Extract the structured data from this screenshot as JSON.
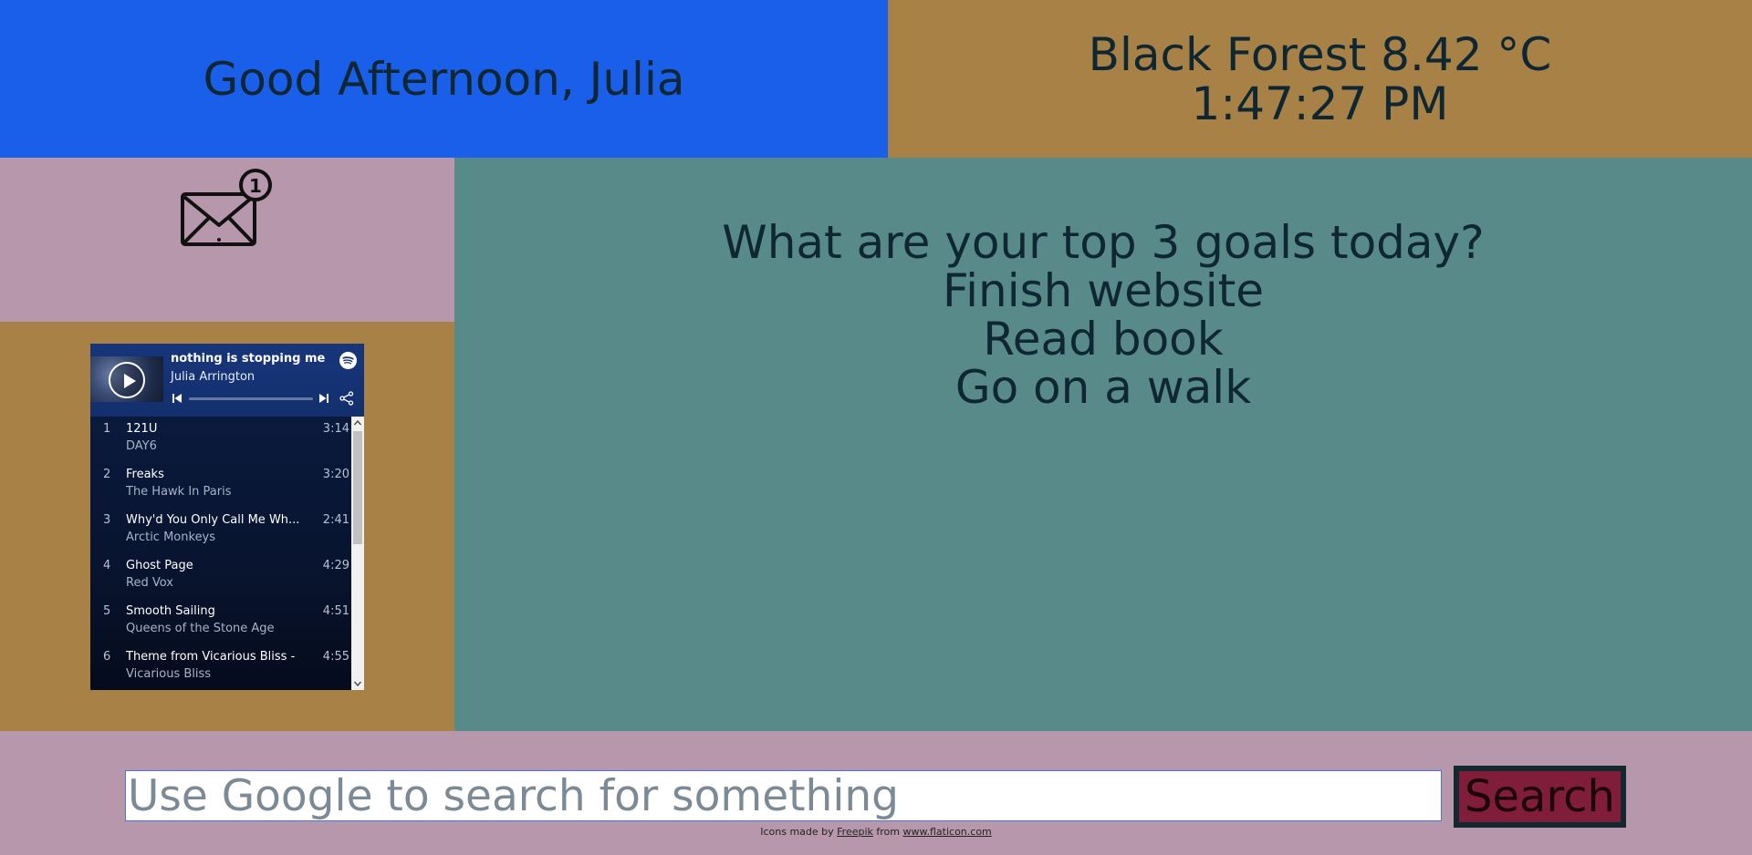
{
  "colors": {
    "greeting_bg": "#1a5fea",
    "weather_bg": "#a88146",
    "mail_bg": "#b797ab",
    "player_bg": "#a88146",
    "goals_bg": "#578a89",
    "search_bg": "#b797ab",
    "search_button_bg": "#7f1d3a",
    "text_dark": "#0f2733"
  },
  "greeting": {
    "text": "Good Afternoon, Julia"
  },
  "weather": {
    "location_temp": "Black Forest 8.42 °C",
    "time": "1:47:27 PM"
  },
  "mail": {
    "icon": "mail-notification-icon",
    "unread_count": "1"
  },
  "player": {
    "playlist_title": "nothing is stopping me",
    "owner": "Julia Arrington",
    "icons": [
      "play-icon",
      "spotify-icon",
      "previous-icon",
      "next-icon",
      "share-icon"
    ],
    "tracks": [
      {
        "num": "1",
        "title": "121U",
        "artist": "DAY6",
        "duration": "3:14"
      },
      {
        "num": "2",
        "title": "Freaks",
        "artist": "The Hawk In Paris",
        "duration": "3:20"
      },
      {
        "num": "3",
        "title": "Why'd You Only Call Me Wh...",
        "artist": "Arctic Monkeys",
        "duration": "2:41"
      },
      {
        "num": "4",
        "title": "Ghost Page",
        "artist": "Red Vox",
        "duration": "4:29"
      },
      {
        "num": "5",
        "title": "Smooth Sailing",
        "artist": "Queens of the Stone Age",
        "duration": "4:51"
      },
      {
        "num": "6",
        "title": "Theme from Vicarious Bliss - ...",
        "artist": "Vicarious Bliss",
        "duration": "4:55"
      }
    ]
  },
  "goals": {
    "question": "What are your top 3 goals today?",
    "items": [
      "Finish website",
      "Read book",
      "Go on a walk"
    ]
  },
  "search": {
    "placeholder": "Use Google to search for something",
    "value": "",
    "button_label": "Search"
  },
  "credit": {
    "prefix": "Icons made by",
    "author": "Freepik",
    "middle": "from",
    "site": "www.flaticon.com"
  }
}
